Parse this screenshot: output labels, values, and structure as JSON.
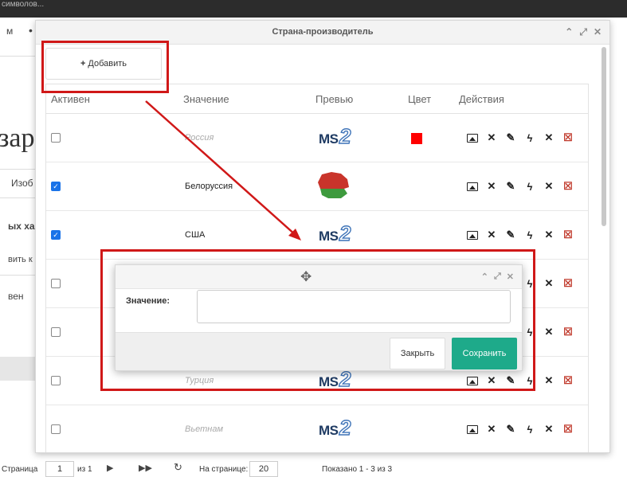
{
  "topbar": {
    "text": "символов..."
  },
  "background": {
    "frag_m": "м",
    "frag_big": "зар",
    "frag_izob": "Изоб",
    "frag_xa": "ых ха",
    "frag_vit": "вить к",
    "frag_ven": "вен"
  },
  "dialog": {
    "title": "Страна-производитель",
    "add_label": "Добавить",
    "columns": [
      "Активен",
      "Значение",
      "Превью",
      "Цвет",
      "Действия"
    ],
    "rows": [
      {
        "active": false,
        "value": "Россия",
        "dim": true,
        "preview": "ms2-logo",
        "color": "#ff0000"
      },
      {
        "active": true,
        "value": "Белоруссия",
        "dim": false,
        "preview": "belarus-map",
        "color": ""
      },
      {
        "active": true,
        "value": "США",
        "dim": false,
        "preview": "ms2-logo",
        "color": ""
      },
      {
        "active": false,
        "value": "",
        "dim": false,
        "preview": "",
        "color": ""
      },
      {
        "active": false,
        "value": "",
        "dim": false,
        "preview": "",
        "color": ""
      },
      {
        "active": false,
        "value": "Турция",
        "dim": true,
        "preview": "ms2-logo",
        "color": ""
      },
      {
        "active": false,
        "value": "Вьетнам",
        "dim": true,
        "preview": "ms2-logo",
        "color": ""
      }
    ],
    "logo_text": "MS",
    "logo_digit": "2"
  },
  "inner_dialog": {
    "label": "Значение:",
    "input_value": "",
    "close_label": "Закрыть",
    "save_label": "Сохранить"
  },
  "pager": {
    "page_label": "Страница",
    "page_value": "1",
    "of_label": "из 1",
    "per_page_label": "На странице:",
    "per_page_value": "20",
    "shown": "Показано 1 - 3 из 3"
  },
  "colors": {
    "accent": "#1eaa8a",
    "annotation": "#d01818",
    "checkbox": "#1a73e8"
  }
}
